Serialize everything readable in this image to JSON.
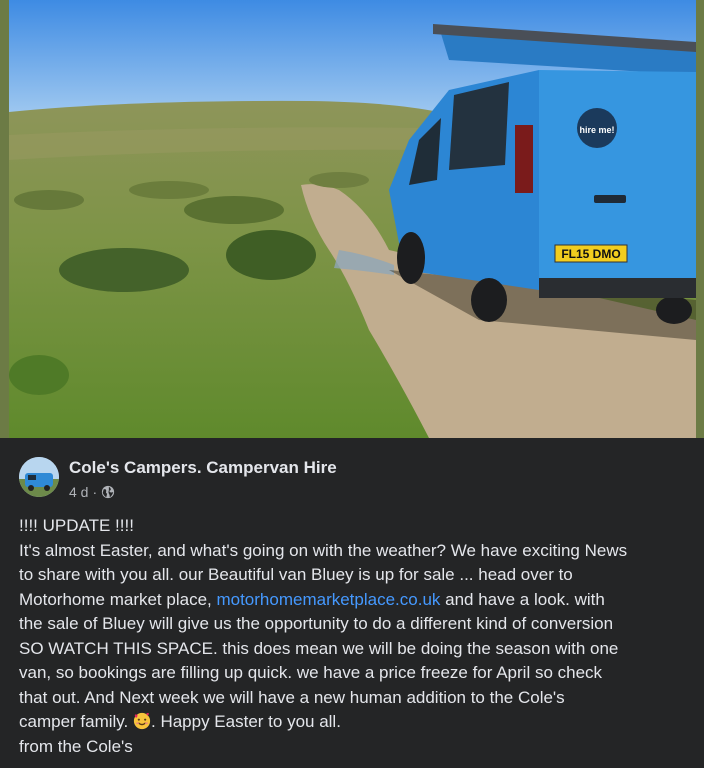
{
  "post": {
    "page_name": "Cole's Campers. Campervan Hire",
    "timestamp": "4 d",
    "separator": "·",
    "privacy_icon": "globe-icon",
    "photo": {
      "van_sticker": "hire me!",
      "license_plate": "FL15 DMO"
    },
    "lines": [
      "!!!! UPDATE !!!!",
      "It's almost Easter, and what's going on with the weather? We have exciting News",
      "to share with you all. our Beautiful van Bluey is up for sale ... head over to",
      {
        "before": "Motorhome market place, ",
        "link": "motorhomemarketplace.co.uk",
        "after": " and have a look. with"
      },
      "the sale of Bluey will give us the opportunity to do a different kind of conversion",
      "SO WATCH THIS SPACE. this does mean we will be doing the season with one",
      "van, so bookings are filling up quick. we have a price freeze for April so check",
      "that out. And Next week we will have a new human addition to the Cole's",
      {
        "before": "camper family. ",
        "emoji": "smiling-face-with-hearts-emoji",
        "after": ". Happy Easter to you all."
      },
      "from the Cole's"
    ]
  },
  "colors": {
    "background": "#242526",
    "text": "#e4e6eb",
    "secondary_text": "#b0b3b8",
    "link": "#4599ff",
    "van_blue": "#2f8ad6"
  }
}
